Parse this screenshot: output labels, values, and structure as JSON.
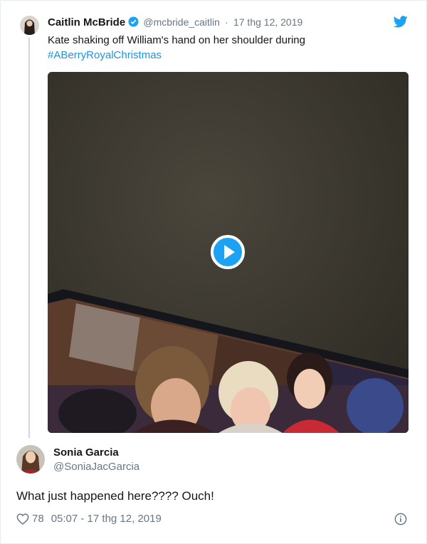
{
  "tweet": {
    "author_name": "Caitlin McBride",
    "handle": "@mcbride_caitlin",
    "separator": "·",
    "date": "17 thg 12, 2019",
    "text": "Kate shaking off William's hand on her shoulder during",
    "hashtag": "#ABerryRoyalChristmas",
    "verified": true,
    "media": {
      "type": "video",
      "play_icon": "play-icon"
    }
  },
  "embed": {
    "author_name": "Sonia Garcia",
    "handle": "@SoniaJacGarcia",
    "text": "What just happened here???? Ouch!",
    "like_count": "78",
    "timestamp": "05:07 - 17 thg 12, 2019"
  },
  "colors": {
    "accent": "#1b95e0",
    "muted": "#657786",
    "twitter": "#1da1f2",
    "border": "#e6ecf0"
  }
}
